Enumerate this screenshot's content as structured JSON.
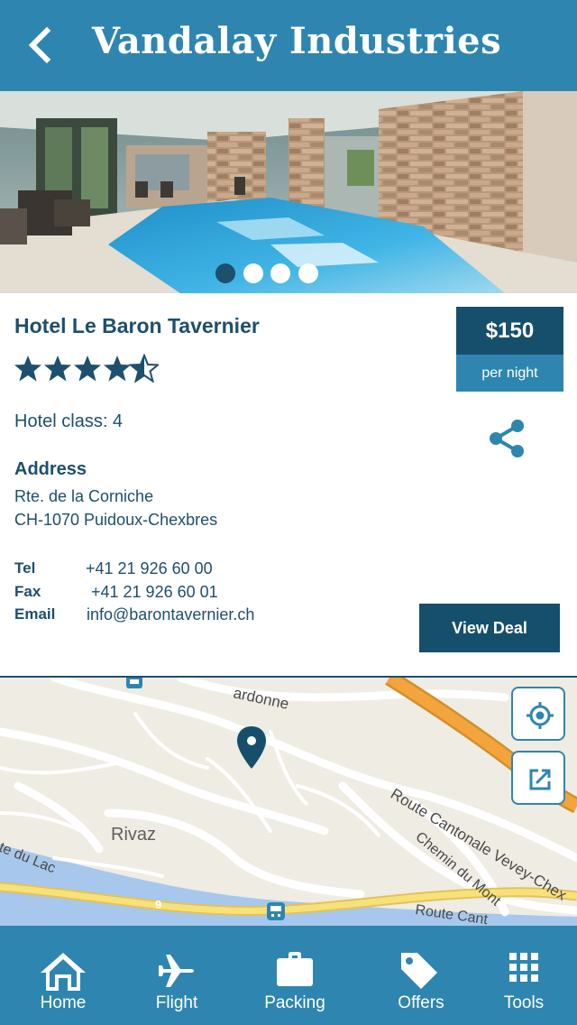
{
  "header": {
    "title": "Vandalay Industries",
    "back_icon": "chevron-left-icon"
  },
  "carousel": {
    "slide_count": 4,
    "active_index": 0
  },
  "hotel": {
    "name": "Hotel Le Baron Tavernier",
    "rating": 4.5,
    "rating_max": 5,
    "class_text": "Hotel class: 4",
    "price": "$150",
    "price_unit": "per night",
    "address_heading": "Address",
    "address_line1": "Rte. de la Corniche",
    "address_line2": "CH-1070 Puidoux-Chexbres",
    "contact": {
      "tel_label": "Tel",
      "tel_value": "+41 21 926 60 00",
      "fax_label": "Fax",
      "fax_value": "+41 21 926 60 01",
      "email_label": "Email",
      "email_value": "info@barontavernier.ch"
    },
    "view_deal_label": "View Deal",
    "share_icon": "share-icon"
  },
  "map": {
    "labels": {
      "town": "Rivaz",
      "road_top": "ardonne",
      "road_cantonale": "Route Cantonale Vevey-Chex",
      "road_mont": "Chemin du Mont",
      "road_lac": "te du Lac",
      "road_cant2": "Route Cant",
      "road_number": "9"
    },
    "locate_icon": "crosshair-icon",
    "open_icon": "external-link-icon",
    "marker_icon": "map-pin-icon"
  },
  "tabs": [
    {
      "label": "Home",
      "icon": "home-icon"
    },
    {
      "label": "Flight",
      "icon": "airplane-icon"
    },
    {
      "label": "Packing",
      "icon": "briefcase-icon"
    },
    {
      "label": "Offers",
      "icon": "tag-icon"
    },
    {
      "label": "Tools",
      "icon": "grid-icon"
    }
  ],
  "colors": {
    "primary": "#2e86b0",
    "dark": "#164f6c",
    "text": "#1d4f6e"
  }
}
